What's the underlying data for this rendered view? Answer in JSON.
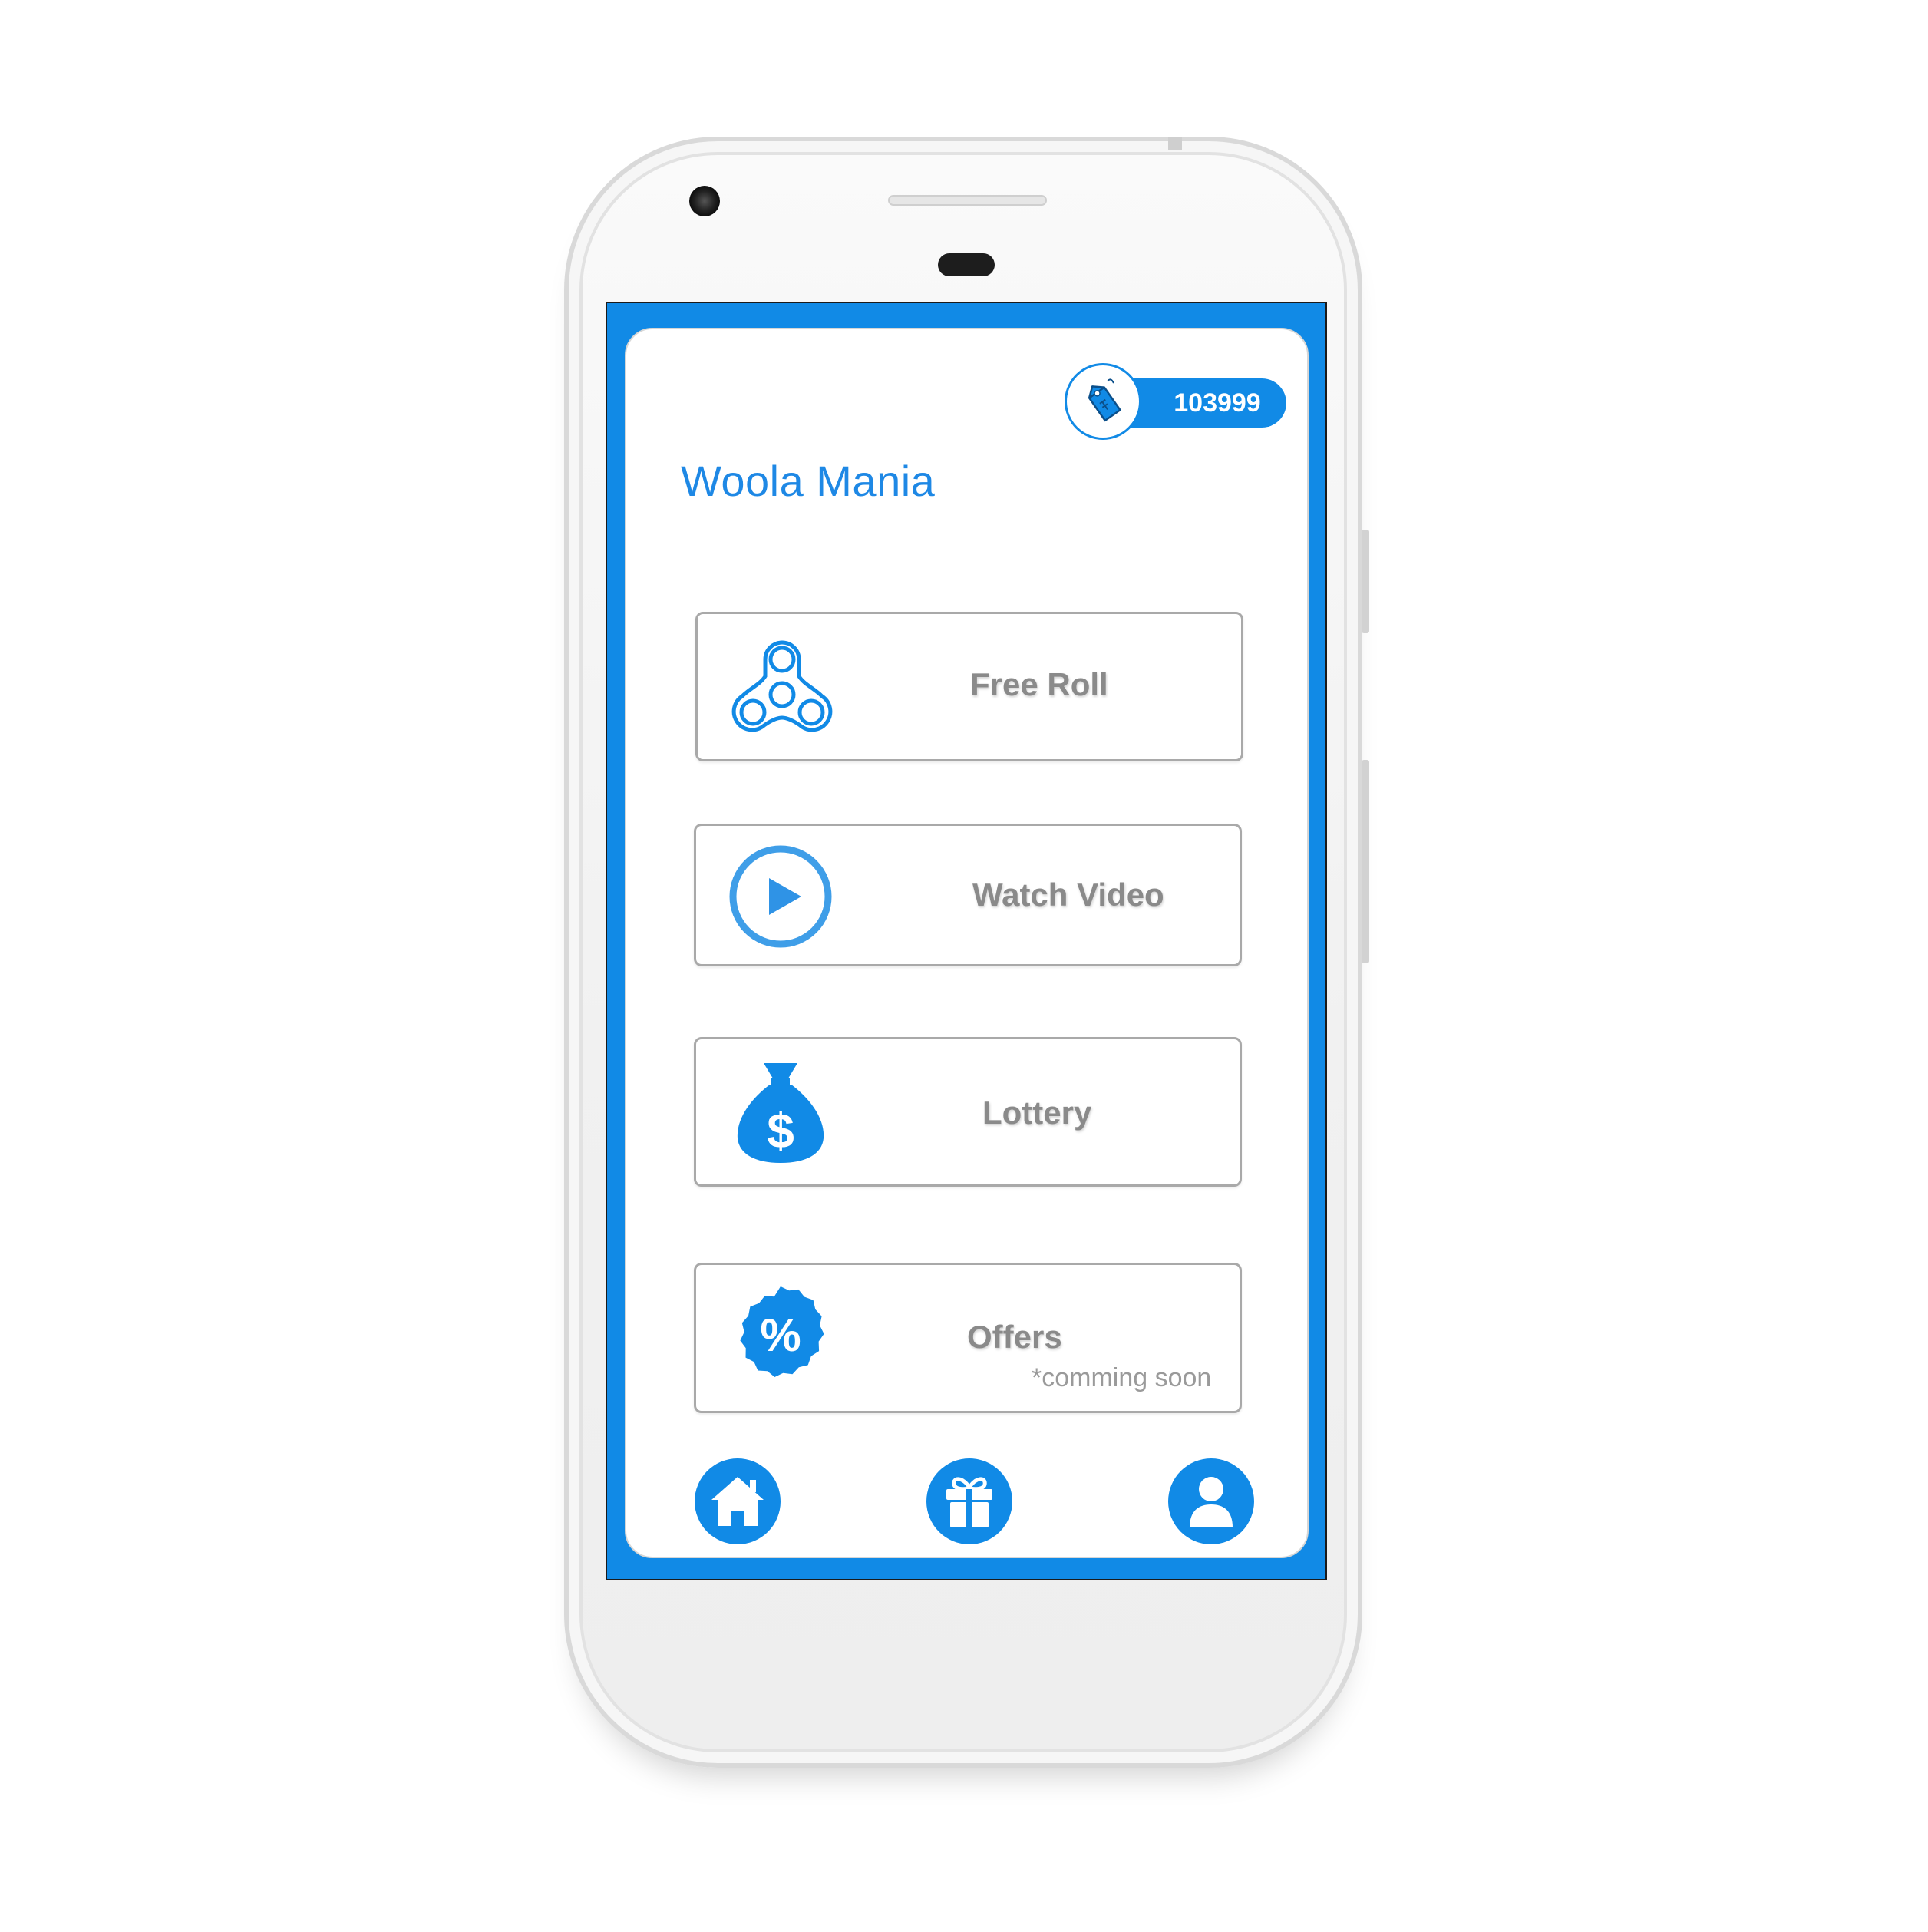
{
  "app": {
    "title": "Woola Mania",
    "coins": "103999",
    "accent_color": "#118ae6",
    "coins_icon": "price-tag-icon"
  },
  "menu": [
    {
      "id": "free-roll",
      "label": "Free Roll",
      "icon": "fidget-spinner-icon",
      "note": ""
    },
    {
      "id": "watch-video",
      "label": "Watch Video",
      "icon": "play-circle-icon",
      "note": ""
    },
    {
      "id": "lottery",
      "label": "Lottery",
      "icon": "money-bag-icon",
      "note": ""
    },
    {
      "id": "offers",
      "label": "Offers",
      "icon": "discount-badge-icon",
      "note": "*comming soon"
    }
  ],
  "bottom_nav": [
    {
      "id": "home",
      "icon": "home-icon"
    },
    {
      "id": "gift",
      "icon": "gift-icon"
    },
    {
      "id": "profile",
      "icon": "user-icon"
    }
  ]
}
